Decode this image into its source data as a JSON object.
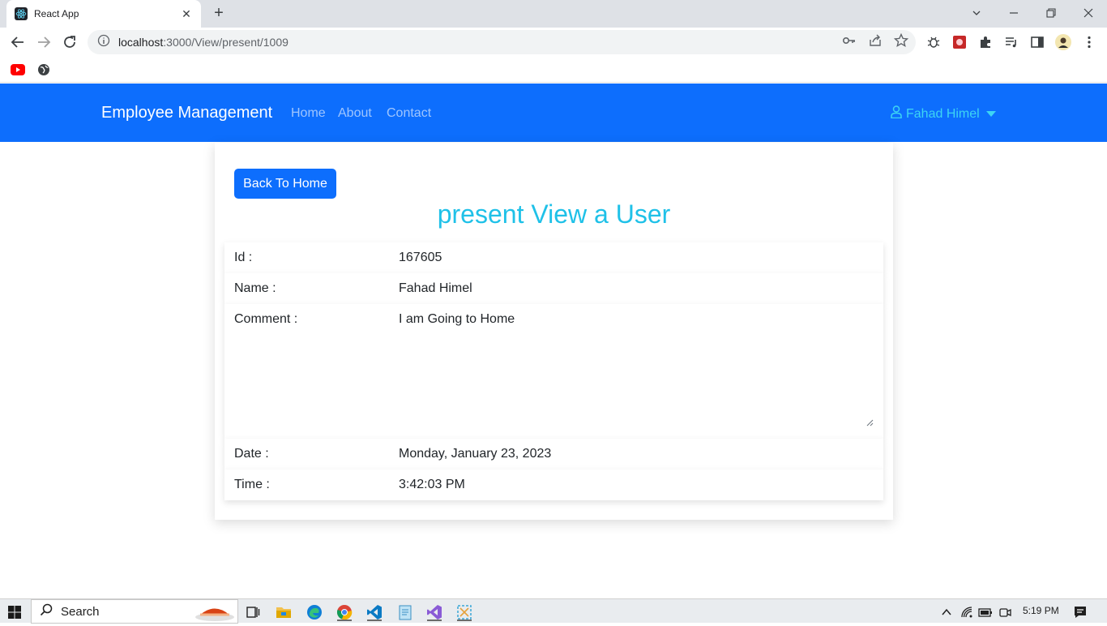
{
  "browser": {
    "tab_title": "React App",
    "tab_close": "✕",
    "new_tab": "+",
    "url_host": "localhost",
    "url_path": ":3000/View/present/1009"
  },
  "navbar": {
    "brand": "Employee Management",
    "links": [
      "Home",
      "About",
      "Contact"
    ],
    "user_name": "Fahad Himel"
  },
  "card": {
    "back_button": "Back To Home",
    "heading": "present View a User",
    "fields": [
      {
        "label": "Id :",
        "value": "167605"
      },
      {
        "label": "Name :",
        "value": "Fahad Himel"
      },
      {
        "label": "Comment :",
        "value": "I am Going to Home"
      },
      {
        "label": "Date :",
        "value": "Monday, January 23, 2023"
      },
      {
        "label": "Time :",
        "value": "3:42:03 PM"
      }
    ]
  },
  "taskbar": {
    "search_label": "Search",
    "time": "5:19 PM"
  },
  "colors": {
    "primary": "#0d6efd",
    "heading": "#1fc1e8",
    "user_link": "#3dd5f3"
  }
}
